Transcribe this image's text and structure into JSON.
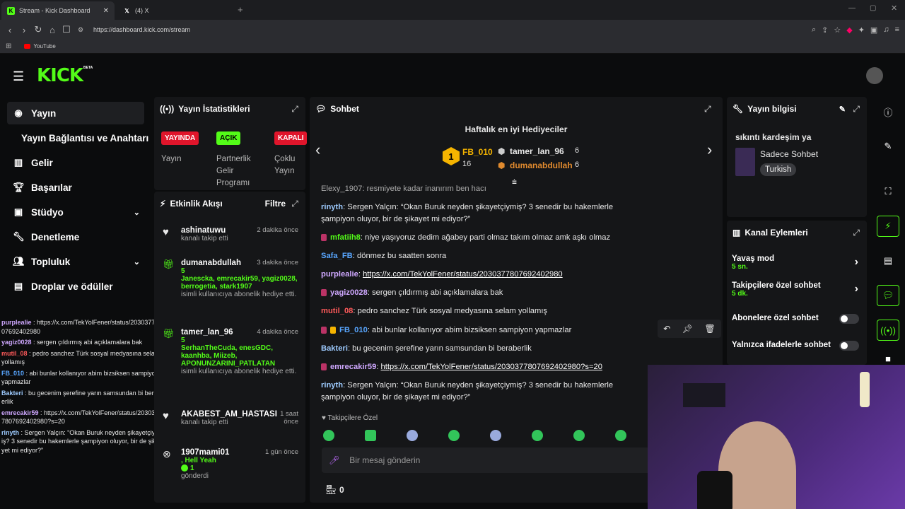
{
  "browser": {
    "tabs": [
      {
        "label": "Stream - Kick Dashboard",
        "icon": "kick-favicon"
      },
      {
        "label": "(4) X",
        "icon": "x-favicon"
      }
    ],
    "url": "https://dashboard.kick.com/stream",
    "bookmark": "YouTube"
  },
  "brand": {
    "logo": "KICK",
    "beta": "BETA",
    "accent": "#53fc18"
  },
  "sidebar": {
    "items": [
      {
        "label": "Yayın",
        "icon": "broadcast-icon"
      },
      {
        "label": "Yayın Bağlantısı ve Anahtarı",
        "icon": ""
      },
      {
        "label": "Gelir",
        "icon": "revenue-icon"
      },
      {
        "label": "Başarılar",
        "icon": "trophy-icon"
      },
      {
        "label": "Stüdyo",
        "icon": "studio-icon"
      },
      {
        "label": "Denetleme",
        "icon": "wrench-icon"
      },
      {
        "label": "Topluluk",
        "icon": "people-icon"
      },
      {
        "label": "Droplar ve ödüller",
        "icon": "drops-icon"
      }
    ]
  },
  "left_chat": [
    {
      "user": "purplealie",
      "text": " : https://x.com/TekYolFener/status/2030377807692402980",
      "color": "#cfa8ff"
    },
    {
      "user": "yagiz0028",
      "text": " : sergen çıldırmış abi açıklamalara bak",
      "color": "#cfa8ff"
    },
    {
      "user": "mutil_08",
      "text": " : pedro sanchez Türk sosyal medyasına selam yollamış",
      "color": "#ff5a5a"
    },
    {
      "user": "FB_010",
      "text": " : abi bunlar kollanıyor abim bizsiksen sampiyon yapmazlar",
      "color": "#58a6ff"
    },
    {
      "user": "Bakteri",
      "text": " : bu gecenim şerefine yarın samsundan bi beraberlik",
      "color": "#9ecbff"
    },
    {
      "user": "emrecakir59",
      "text": " : https://x.com/TekYolFener/status/2030377807692402980?s=20",
      "color": "#cfa8ff"
    },
    {
      "user": "rinyth",
      "text": " : Sergen Yalçın: “Okan Buruk neyden şikayetçiymiş? 3 senedir bu hakemlerle şampiyon oluyor, bir de şikayet mi ediyor?”",
      "color": "#9ecbff"
    }
  ],
  "stats": {
    "title": "Yayın İstatistikleri",
    "badges": [
      "YAYINDA",
      "AÇIK",
      "KAPALI"
    ],
    "labels": [
      "Yayın",
      "Partnerlik Gelir Programı",
      "Çoklu Yayın"
    ]
  },
  "activity": {
    "title": "Etkinlik Akışı",
    "filter": "Filtre",
    "items": [
      {
        "name": "ashinatuwu",
        "time": "2 dakika önce",
        "detail": "kanalı takip etti",
        "green": ""
      },
      {
        "name": "dumanabdullah",
        "time": "3 dakika önce",
        "green": "5\nJanescka, emrecakir59, yagiz0028, berrogetia, stark1907",
        "detail": "isimli kullanıcıya abonelik hediye etti."
      },
      {
        "name": "tamer_lan_96",
        "time": "4 dakika önce",
        "green": "5\nSerhanTheCuda, enesGDC, kaanhba, Miizeb, APONUNZARINI_PATLATAN",
        "detail": "isimli kullanıcıya abonelik hediye etti."
      },
      {
        "name": "AKABEST_AM_HASTASI",
        "time": "1 saat önce",
        "detail": "kanalı takip etti",
        "green": ""
      },
      {
        "name": "1907mami01",
        "time": "1 gün önce",
        "green": ", Hell Yeah",
        "detail": "gönderdi",
        "count": "1"
      }
    ]
  },
  "chat": {
    "title": "Sohbet",
    "gifters_title": "Haftalık en iyi Hediyeciler",
    "top": {
      "rank": "1",
      "name": "FB_010",
      "count": "16"
    },
    "second": {
      "name": "tamer_lan_96",
      "count": "6"
    },
    "third": {
      "name": "dumanabdullah",
      "count": "6"
    },
    "partial": "Elexy_1907: resmiyete kadar inanırım ben hacı",
    "messages": [
      {
        "user": "rinyth",
        "color": "#9ecbff",
        "text": ": Sergen Yalçın: “Okan Buruk neyden şikayetçiymiş? 3 senedir bu hakemlerle şampiyon oluyor, bir de şikayet mi ediyor?”"
      },
      {
        "user": "mfatiih8",
        "color": "#53fc18",
        "text": ": niye yaşıyoruz dedim ağabey parti olmaz takım olmaz amk aşkı olmaz"
      },
      {
        "user": "Safa_FB",
        "color": "#58a6ff",
        "text": ": dönmez bu saatten sonra"
      },
      {
        "user": "purplealie",
        "color": "#cfa8ff",
        "text": ": ",
        "link": "https://x.com/TekYolFener/status/2030377807692402980"
      },
      {
        "user": "yagiz0028",
        "color": "#cfa8ff",
        "text": ": sergen çıldırmış abi açıklamalara bak"
      },
      {
        "user": "mutil_08",
        "color": "#ff5a5a",
        "text": ": pedro sanchez Türk sosyal medyasına selam yollamış"
      },
      {
        "user": "FB_010",
        "color": "#58a6ff",
        "text": ": abi bunlar kollanıyor abim bizsiksen sampiyon yapmazlar"
      },
      {
        "user": "Bakteri",
        "color": "#9ecbff",
        "text": ": bu gecenim şerefine yarın samsundan bi beraberlik"
      },
      {
        "user": "emrecakir59",
        "color": "#cfa8ff",
        "text": ": ",
        "link": "https://x.com/TekYolFener/status/2030377807692402980?s=20"
      },
      {
        "user": "rinyth",
        "color": "#9ecbff",
        "text": ": Sergen Yalçın: “Okan Buruk neyden şikayetçiymiş? 3 senedir bu hakemlerle şampiyon oluyor, bir de şikayet mi ediyor?”"
      }
    ],
    "followers_only": "Takipçilere Özel",
    "input_placeholder": "Bir mesaj gönderin",
    "points": "0"
  },
  "stream_info": {
    "title": "Yayın bilgisi",
    "stream_title": "sıkıntı kardeşim ya",
    "category": "Sadece Sohbet",
    "language": "Turkish"
  },
  "channel_actions": {
    "title": "Kanal Eylemleri",
    "slow_mode": "Yavaş mod",
    "slow_value": "5 sn.",
    "followers_chat": "Takipçilere özel sohbet",
    "followers_value": "5 dk.",
    "subs_chat": "Abonelere özel sohbet",
    "emote_chat": "Yalnızca ifadelerle sohbet"
  }
}
